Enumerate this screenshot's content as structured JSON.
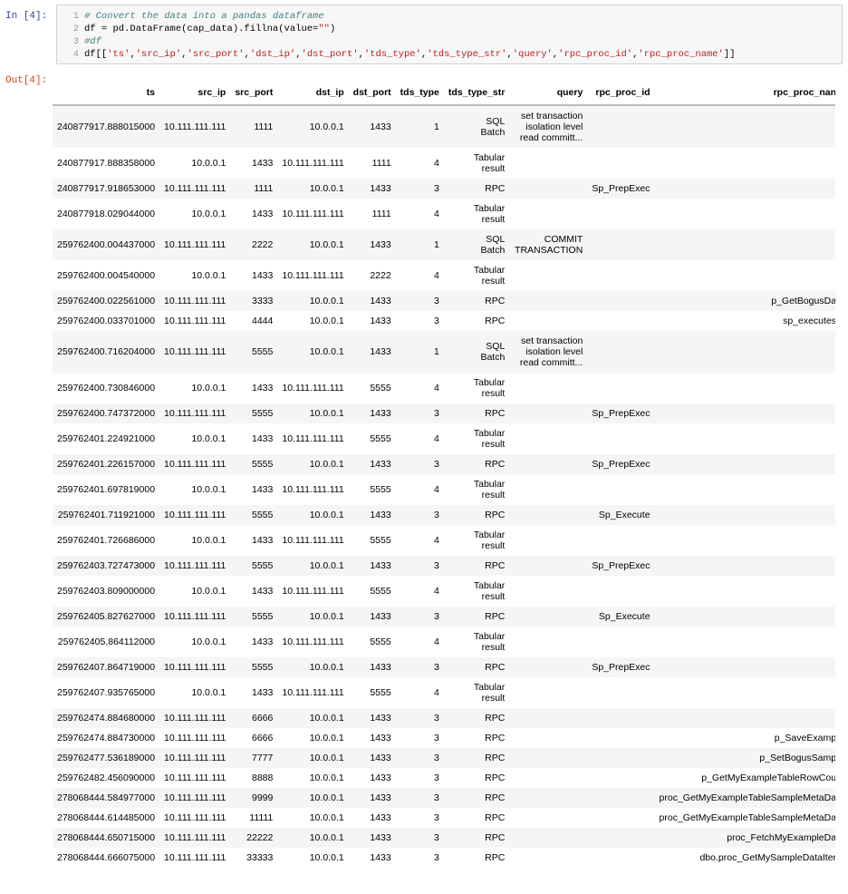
{
  "in_prompt": "In [4]:",
  "out_prompt": "Out[4]:",
  "code": [
    [
      {
        "t": "# Convert the data into a pandas dataframe",
        "c": "comment"
      }
    ],
    [
      {
        "t": "df = pd.DataFrame(cap_data).fillna(value=",
        "c": "plain"
      },
      {
        "t": "\"\"",
        "c": "string"
      },
      {
        "t": ")",
        "c": "plain"
      }
    ],
    [
      {
        "t": "#df",
        "c": "comment"
      }
    ],
    [
      {
        "t": "df[[",
        "c": "plain"
      },
      {
        "t": "'ts'",
        "c": "string"
      },
      {
        "t": ",",
        "c": "plain"
      },
      {
        "t": "'src_ip'",
        "c": "string"
      },
      {
        "t": ",",
        "c": "plain"
      },
      {
        "t": "'src_port'",
        "c": "string"
      },
      {
        "t": ",",
        "c": "plain"
      },
      {
        "t": "'dst_ip'",
        "c": "string"
      },
      {
        "t": ",",
        "c": "plain"
      },
      {
        "t": "'dst_port'",
        "c": "string"
      },
      {
        "t": ",",
        "c": "plain"
      },
      {
        "t": "'tds_type'",
        "c": "string"
      },
      {
        "t": ",",
        "c": "plain"
      },
      {
        "t": "'tds_type_str'",
        "c": "string"
      },
      {
        "t": ",",
        "c": "plain"
      },
      {
        "t": "'query'",
        "c": "string"
      },
      {
        "t": ",",
        "c": "plain"
      },
      {
        "t": "'rpc_proc_id'",
        "c": "string"
      },
      {
        "t": ",",
        "c": "plain"
      },
      {
        "t": "'rpc_proc_name'",
        "c": "string"
      },
      {
        "t": "]]",
        "c": "plain"
      }
    ]
  ],
  "table": {
    "columns": [
      "ts",
      "src_ip",
      "src_port",
      "dst_ip",
      "dst_port",
      "tds_type",
      "tds_type_str",
      "query",
      "rpc_proc_id",
      "rpc_proc_nan"
    ],
    "rows": [
      [
        "240877917.888015000",
        "10.111.111.111",
        "1111",
        "10.0.0.1",
        "1433",
        "1",
        "SQL Batch",
        "set transaction isolation level read committ...",
        "",
        ""
      ],
      [
        "240877917.888358000",
        "10.0.0.1",
        "1433",
        "10.111.111.111",
        "1111",
        "4",
        "Tabular result",
        "",
        "",
        ""
      ],
      [
        "240877917.918653000",
        "10.111.111.111",
        "1111",
        "10.0.0.1",
        "1433",
        "3",
        "RPC",
        "",
        "Sp_PrepExec",
        ""
      ],
      [
        "240877918.029044000",
        "10.0.0.1",
        "1433",
        "10.111.111.111",
        "1111",
        "4",
        "Tabular result",
        "",
        "",
        ""
      ],
      [
        "259762400.004437000",
        "10.111.111.111",
        "2222",
        "10.0.0.1",
        "1433",
        "1",
        "SQL Batch",
        "COMMIT TRANSACTION",
        "",
        ""
      ],
      [
        "259762400.004540000",
        "10.0.0.1",
        "1433",
        "10.111.111.111",
        "2222",
        "4",
        "Tabular result",
        "",
        "",
        ""
      ],
      [
        "259762400.022561000",
        "10.111.111.111",
        "3333",
        "10.0.0.1",
        "1433",
        "3",
        "RPC",
        "",
        "",
        "p_GetBogusDa"
      ],
      [
        "259762400.033701000",
        "10.111.111.111",
        "4444",
        "10.0.0.1",
        "1433",
        "3",
        "RPC",
        "",
        "",
        "sp_executes"
      ],
      [
        "259762400.716204000",
        "10.111.111.111",
        "5555",
        "10.0.0.1",
        "1433",
        "1",
        "SQL Batch",
        "set transaction isolation level read committ...",
        "",
        ""
      ],
      [
        "259762400.730846000",
        "10.0.0.1",
        "1433",
        "10.111.111.111",
        "5555",
        "4",
        "Tabular result",
        "",
        "",
        ""
      ],
      [
        "259762400.747372000",
        "10.111.111.111",
        "5555",
        "10.0.0.1",
        "1433",
        "3",
        "RPC",
        "",
        "Sp_PrepExec",
        ""
      ],
      [
        "259762401.224921000",
        "10.0.0.1",
        "1433",
        "10.111.111.111",
        "5555",
        "4",
        "Tabular result",
        "",
        "",
        ""
      ],
      [
        "259762401.226157000",
        "10.111.111.111",
        "5555",
        "10.0.0.1",
        "1433",
        "3",
        "RPC",
        "",
        "Sp_PrepExec",
        ""
      ],
      [
        "259762401.697819000",
        "10.0.0.1",
        "1433",
        "10.111.111.111",
        "5555",
        "4",
        "Tabular result",
        "",
        "",
        ""
      ],
      [
        "259762401.711921000",
        "10.111.111.111",
        "5555",
        "10.0.0.1",
        "1433",
        "3",
        "RPC",
        "",
        "Sp_Execute",
        ""
      ],
      [
        "259762401.726686000",
        "10.0.0.1",
        "1433",
        "10.111.111.111",
        "5555",
        "4",
        "Tabular result",
        "",
        "",
        ""
      ],
      [
        "259762403.727473000",
        "10.111.111.111",
        "5555",
        "10.0.0.1",
        "1433",
        "3",
        "RPC",
        "",
        "Sp_PrepExec",
        ""
      ],
      [
        "259762403.809000000",
        "10.0.0.1",
        "1433",
        "10.111.111.111",
        "5555",
        "4",
        "Tabular result",
        "",
        "",
        ""
      ],
      [
        "259762405.827627000",
        "10.111.111.111",
        "5555",
        "10.0.0.1",
        "1433",
        "3",
        "RPC",
        "",
        "Sp_Execute",
        ""
      ],
      [
        "259762405.864112000",
        "10.0.0.1",
        "1433",
        "10.111.111.111",
        "5555",
        "4",
        "Tabular result",
        "",
        "",
        ""
      ],
      [
        "259762407.864719000",
        "10.111.111.111",
        "5555",
        "10.0.0.1",
        "1433",
        "3",
        "RPC",
        "",
        "Sp_PrepExec",
        ""
      ],
      [
        "259762407.935765000",
        "10.0.0.1",
        "1433",
        "10.111.111.111",
        "5555",
        "4",
        "Tabular result",
        "",
        "",
        ""
      ],
      [
        "259762474.884680000",
        "10.111.111.111",
        "6666",
        "10.0.0.1",
        "1433",
        "3",
        "RPC",
        "",
        "",
        ""
      ],
      [
        "259762474.884730000",
        "10.111.111.111",
        "6666",
        "10.0.0.1",
        "1433",
        "3",
        "RPC",
        "",
        "",
        "p_SaveExamp"
      ],
      [
        "259762477.536189000",
        "10.111.111.111",
        "7777",
        "10.0.0.1",
        "1433",
        "3",
        "RPC",
        "",
        "",
        "p_SetBogusSamp"
      ],
      [
        "259762482.456090000",
        "10.111.111.111",
        "8888",
        "10.0.0.1",
        "1433",
        "3",
        "RPC",
        "",
        "",
        "p_GetMyExampleTableRowCou"
      ],
      [
        "278068444.584977000",
        "10.111.111.111",
        "9999",
        "10.0.0.1",
        "1433",
        "3",
        "RPC",
        "",
        "",
        "proc_GetMyExampleTableSampleMetaDa"
      ],
      [
        "278068444.614485000",
        "10.111.111.111",
        "11111",
        "10.0.0.1",
        "1433",
        "3",
        "RPC",
        "",
        "",
        "proc_GetMyExampleTableSampleMetaDa"
      ],
      [
        "278068444.650715000",
        "10.111.111.111",
        "22222",
        "10.0.0.1",
        "1433",
        "3",
        "RPC",
        "",
        "",
        "proc_FetchMyExampleDa"
      ],
      [
        "278068444.666075000",
        "10.111.111.111",
        "33333",
        "10.0.0.1",
        "1433",
        "3",
        "RPC",
        "",
        "",
        "dbo.proc_GetMySampleDataIter"
      ]
    ]
  }
}
